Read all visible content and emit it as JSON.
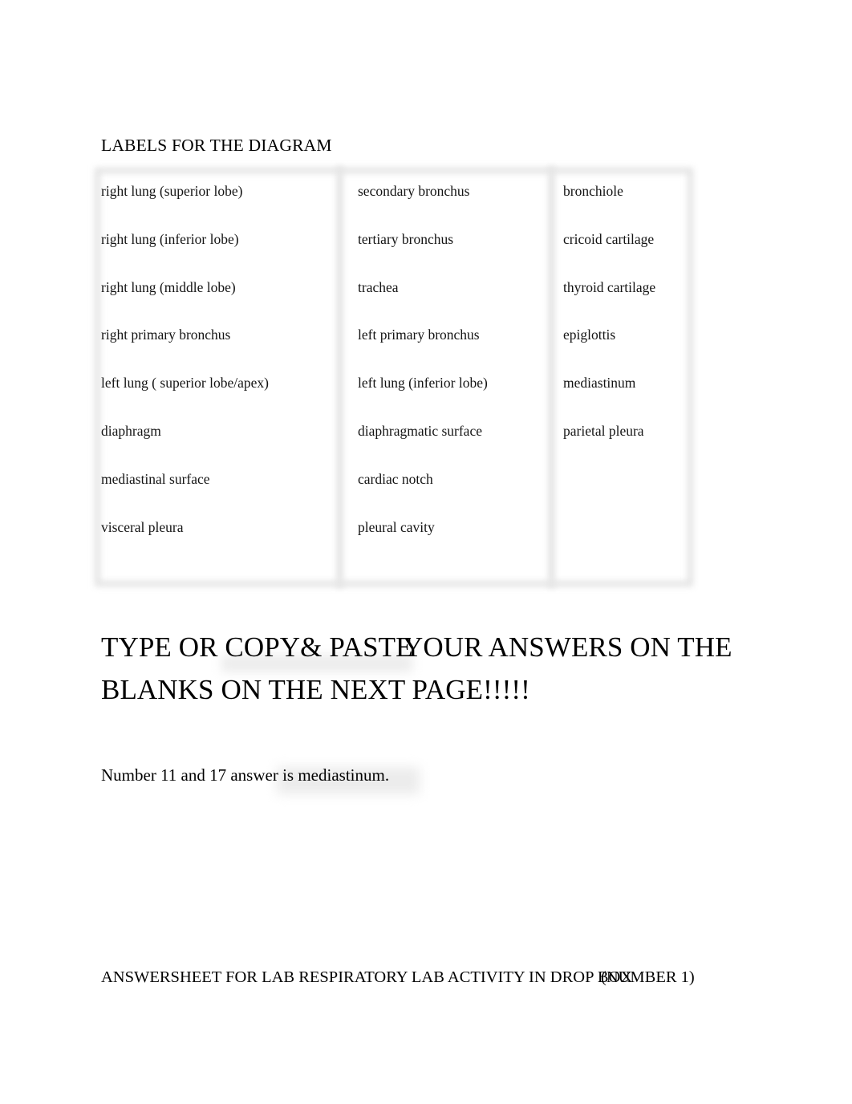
{
  "document": {
    "heading": "LABELS FOR THE DIAGRAM",
    "background_color": "#ffffff",
    "text_color": "#000000",
    "table_border_color": "#e3e3e3"
  },
  "label_table": {
    "columns": [
      {
        "name": "column-1",
        "cells": [
          "right lung (superior lobe)",
          "right lung (inferior lobe)",
          "right lung (middle lobe)",
          "right primary bronchus",
          "left lung ( superior lobe/apex)",
          "diaphragm",
          "mediastinal surface",
          "visceral pleura"
        ]
      },
      {
        "name": "column-2",
        "cells": [
          "secondary bronchus",
          "tertiary bronchus",
          "trachea",
          "left primary bronchus",
          "left lung (inferior lobe)",
          "diaphragmatic surface",
          "cardiac notch",
          "pleural cavity"
        ]
      },
      {
        "name": "column-3",
        "cells": [
          "bronchiole",
          "cricoid cartilage",
          "thyroid cartilage",
          "epiglottis",
          "mediastinum",
          "parietal pleura",
          "",
          ""
        ]
      }
    ]
  },
  "big_title": {
    "line1_a": "TYPE OR COPY& PASTE",
    "line1_overlap": "YOUR ANSWERS ON THE",
    "line2": "BLANKS ON THE NEXT PAGE!!!!!"
  },
  "answer_note": {
    "prefix": "Number 11 and 17 answer is ",
    "answer": " mediastinum."
  },
  "footer": {
    "main": "ANSWERSHEET FOR LAB RESPIRATORY LAB ACTIVITY IN DROP BOX",
    "overlap": "(NUMBER 1)"
  }
}
